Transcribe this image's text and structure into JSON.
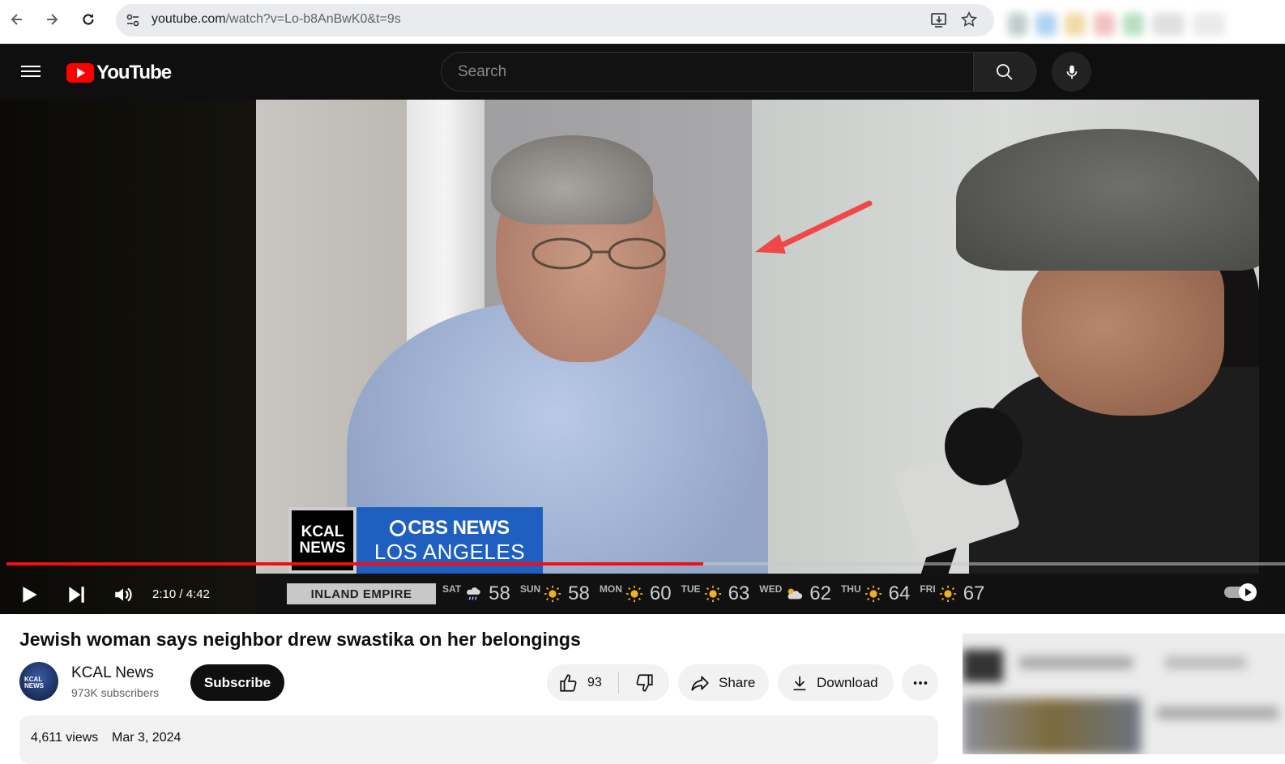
{
  "browser": {
    "url_host": "youtube.com",
    "url_path": "/watch?v=Lo-b8AnBwK0&t=9s"
  },
  "header": {
    "logo_text": "YouTube",
    "search_placeholder": "Search"
  },
  "player": {
    "time": "2:10 / 4:42",
    "progress_fraction": 0.545,
    "lower_third": {
      "station_line1": "KCAL",
      "station_line2": "NEWS",
      "network_line1": "CBS NEWS",
      "network_line2": "LOS ANGELES"
    },
    "weather": {
      "region": "INLAND EMPIRE",
      "days": [
        {
          "day": "SAT",
          "icon": "rain-icon",
          "temp": "58"
        },
        {
          "day": "SUN",
          "icon": "sun-icon",
          "temp": "58"
        },
        {
          "day": "MON",
          "icon": "sun-icon",
          "temp": "60"
        },
        {
          "day": "TUE",
          "icon": "sun-icon",
          "temp": "63"
        },
        {
          "day": "WED",
          "icon": "cloud-icon",
          "temp": "62"
        },
        {
          "day": "THU",
          "icon": "sun-icon",
          "temp": "64"
        },
        {
          "day": "FRI",
          "icon": "sun-icon",
          "temp": "67"
        }
      ]
    }
  },
  "video": {
    "title": "Jewish woman says neighbor drew swastika on her belongings",
    "channel": "KCAL News",
    "subscribers": "973K subscribers",
    "subscribe_label": "Subscribe",
    "likes": "93",
    "share_label": "Share",
    "download_label": "Download",
    "views": "4,611 views",
    "date": "Mar 3, 2024"
  },
  "colors": {
    "brand_red": "#ff0000",
    "progress_red": "#e11111",
    "header_bg": "#0f0f0f"
  }
}
